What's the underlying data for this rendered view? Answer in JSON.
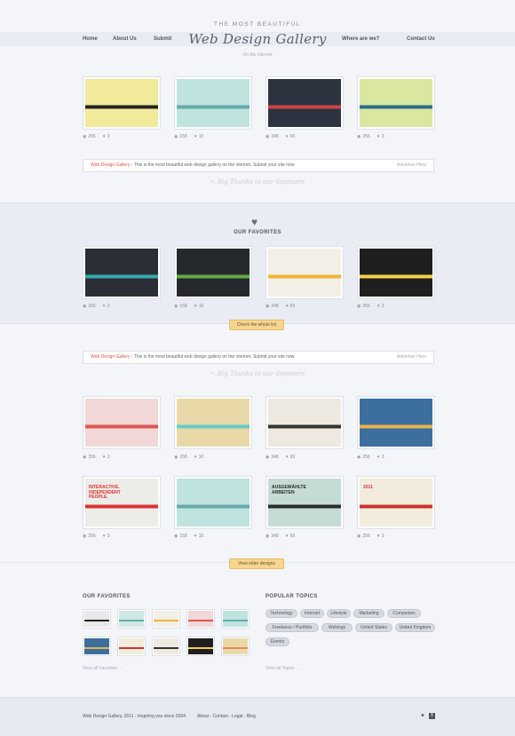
{
  "header": {
    "tagline_top": "THE MOST BEAUTIFUL",
    "logo": "Web Design Gallery",
    "tagline_bottom": "On the Internet",
    "nav_left": [
      "Home",
      "About  Us",
      "Submit"
    ],
    "nav_right": [
      "Where are we?",
      "Contact Us"
    ]
  },
  "colors": {
    "accent": "#f7d58f",
    "brand_red": "#e2553a",
    "band": "#e9ecf2"
  },
  "row1": [
    {
      "views": "256",
      "likes": "3",
      "palette": [
        "#f1ea9a",
        "#222"
      ]
    },
    {
      "views": "158",
      "likes": "10",
      "palette": [
        "#bfe3df",
        "#6aa"
      ]
    },
    {
      "views": "348",
      "likes": "65",
      "palette": [
        "#2d3440",
        "#c44"
      ]
    },
    {
      "views": "256",
      "likes": "3",
      "palette": [
        "#d9e7a0",
        "#2a6b8a"
      ]
    }
  ],
  "ad": {
    "brand": "Web Design Gallery",
    "text": " - This is the most beautiful web design gallery on the internet, Submit your site now",
    "advertise": "Advertise Here",
    "thanks": "Big Thanks to our Sponsors"
  },
  "favorites_section": {
    "title": "OUR FAVORITES",
    "button": "Check the whole list",
    "items": [
      {
        "views": "256",
        "likes": "3",
        "palette": [
          "#2b2e36",
          "#3aa"
        ]
      },
      {
        "views": "158",
        "likes": "10",
        "palette": [
          "#25282d",
          "#6a4"
        ]
      },
      {
        "views": "348",
        "likes": "65",
        "palette": [
          "#f3efe6",
          "#f2b23a"
        ]
      },
      {
        "views": "256",
        "likes": "3",
        "palette": [
          "#1f1f1f",
          "#f2d04a"
        ]
      }
    ]
  },
  "ad2": {
    "brand": "Web Design Gallery",
    "text": " - This is the most beautiful web design gallery on the internet, Submit your site now",
    "advertise": "Advertise Here",
    "thanks": "Big Thanks to our Sponsors"
  },
  "row3": [
    {
      "views": "256",
      "likes": "3",
      "palette": [
        "#f2d7d7",
        "#d55"
      ]
    },
    {
      "views": "158",
      "likes": "10",
      "palette": [
        "#e9d9a9",
        "#6cc"
      ]
    },
    {
      "views": "348",
      "likes": "65",
      "palette": [
        "#eee9e0",
        "#333"
      ]
    },
    {
      "views": "256",
      "likes": "3",
      "palette": [
        "#3c6f9e",
        "#e8b24a"
      ]
    }
  ],
  "row4": [
    {
      "views": "256",
      "likes": "3",
      "palette": [
        "#ecece8",
        "#d33"
      ],
      "caption": "INTERACTIVE. INDEPENDENT PEOPLE."
    },
    {
      "views": "158",
      "likes": "10",
      "palette": [
        "#bfe3df",
        "#6aa"
      ]
    },
    {
      "views": "348",
      "likes": "65",
      "palette": [
        "#c5dcd5",
        "#2b2b2b"
      ],
      "caption": "AUSGEWÄHLTE ARBEITEN"
    },
    {
      "views": "256",
      "likes": "3",
      "palette": [
        "#f2ecdc",
        "#c33"
      ],
      "caption": "2011"
    }
  ],
  "older_button": "View older designs",
  "bottom": {
    "favorites_title": "OUR FAVORITES",
    "favorites_view_all": "View all Favorites",
    "small_thumbs": [
      [
        "#e8e8e8",
        "#222"
      ],
      [
        "#cfe8e4",
        "#6aa"
      ],
      [
        "#f3efe6",
        "#f2b23a"
      ],
      [
        "#f2d7d7",
        "#d55"
      ],
      [
        "#bfe3df",
        "#6aa"
      ],
      [
        "#3c6f9e",
        "#e8b24a"
      ],
      [
        "#f2ecdc",
        "#c33"
      ],
      [
        "#eee9e0",
        "#333"
      ],
      [
        "#1f1f1f",
        "#f2d04a"
      ],
      [
        "#e9d9a9",
        "#e85"
      ]
    ],
    "topics_title": "POPULAR TOPICS",
    "topics": [
      "Technology",
      "Internet",
      "Lifestyle",
      "Marketing",
      "Companies",
      "Freelance / Portfolio",
      "Weblogs",
      "United States",
      "United Kingdom",
      "Events"
    ],
    "topics_view_all": "View all Topics"
  },
  "footer": {
    "copyright": "Web Design Gallery, 2011 - Inspiring you since 2004.",
    "links": "About - Contact - Legal - Blog"
  }
}
